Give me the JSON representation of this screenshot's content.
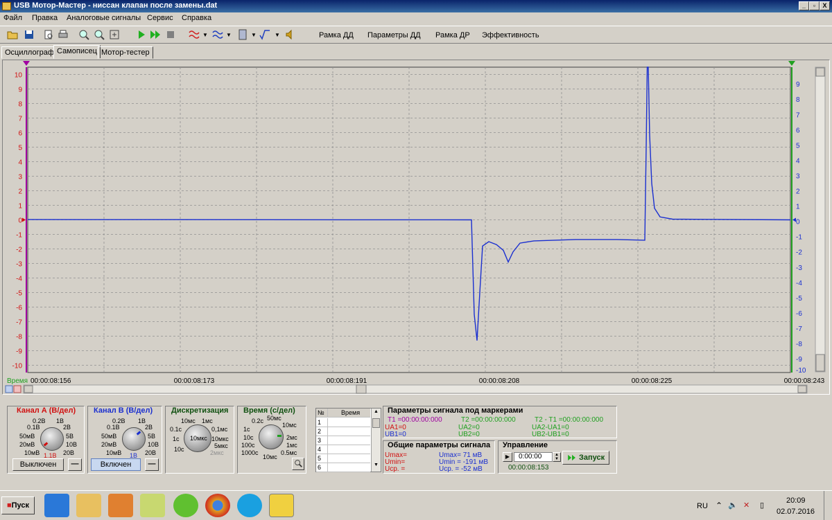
{
  "window": {
    "title": "USB Мотор-Мастер - ниссан клапан после замены.dat",
    "buttons": [
      "_",
      "▫",
      "X"
    ]
  },
  "menu": [
    "Файл",
    "Правка",
    "Аналоговые сигналы",
    "Сервис",
    "Справка"
  ],
  "toolbar": {
    "text_buttons": [
      "Рамка ДД",
      "Параметры ДД",
      "Рамка ДР",
      "Эффективность"
    ]
  },
  "tabs": [
    "Осциллограф",
    "Самописец",
    "Мотор-тестер"
  ],
  "active_tab": "Самописец",
  "plot": {
    "left_ticks": [
      "10",
      "9",
      "8",
      "7",
      "6",
      "5",
      "4",
      "3",
      "2",
      "1",
      "0",
      "-1",
      "-2",
      "-3",
      "-4",
      "-5",
      "-6",
      "-7",
      "-8",
      "-9",
      "-10"
    ],
    "right_ticks": [
      "9",
      "8",
      "7",
      "6",
      "5",
      "4",
      "3",
      "2",
      "1",
      "0",
      "-1",
      "-2",
      "-3",
      "-4",
      "-5",
      "-6",
      "-7",
      "-8",
      "-9",
      "-10"
    ],
    "time_label": "Время",
    "time_ticks": [
      "00:00:08:156",
      "00:00:08:173",
      "00:00:08:191",
      "00:00:08:208",
      "00:00:08:225",
      "00:00:08:243"
    ],
    "colors": {
      "grid": "#909090",
      "signal": "#1a2fd0",
      "left_axis": "#d01010",
      "right_axis": "#1a2fd0",
      "marker_left": "#a000a0",
      "marker_right": "#20a020"
    }
  },
  "chart_data": {
    "type": "line",
    "title": "",
    "xlabel": "Время",
    "ylabel": "",
    "xlim": [
      "00:00:08:156",
      "00:00:08:260"
    ],
    "ylim": [
      -10.5,
      10.5
    ],
    "grid": true,
    "series": [
      {
        "name": "",
        "color": "#1a2fd0",
        "points": [
          {
            "t": 0,
            "v": 0.02
          },
          {
            "t": 64,
            "v": 0.0
          },
          {
            "t": 64.4,
            "v": -6.5
          },
          {
            "t": 64.8,
            "v": -8.3
          },
          {
            "t": 65.2,
            "v": -5.0
          },
          {
            "t": 65.6,
            "v": -1.8
          },
          {
            "t": 66.5,
            "v": -1.5
          },
          {
            "t": 67.6,
            "v": -1.7
          },
          {
            "t": 68.6,
            "v": -2.1
          },
          {
            "t": 69.3,
            "v": -2.9
          },
          {
            "t": 70.0,
            "v": -2.2
          },
          {
            "t": 71.0,
            "v": -1.6
          },
          {
            "t": 73.0,
            "v": -1.45
          },
          {
            "t": 79.0,
            "v": -1.35
          },
          {
            "t": 85.0,
            "v": -1.35
          },
          {
            "t": 89.0,
            "v": -1.4
          },
          {
            "t": 89.2,
            "v": 5.0
          },
          {
            "t": 89.35,
            "v": 10.5
          },
          {
            "t": 89.5,
            "v": 10.5
          },
          {
            "t": 89.7,
            "v": 5.8
          },
          {
            "t": 90.0,
            "v": 2.5
          },
          {
            "t": 90.4,
            "v": 0.8
          },
          {
            "t": 91.2,
            "v": 0.2
          },
          {
            "t": 93.0,
            "v": 0.05
          },
          {
            "t": 110,
            "v": 0.0
          }
        ]
      }
    ]
  },
  "channel_a": {
    "title": "Канал А (В/дел)",
    "labels": [
      "0.2В",
      "1В",
      "0.1В",
      "2В",
      "50мВ",
      "5В",
      "20мВ",
      "10В",
      "10мВ",
      "20В"
    ],
    "value": "1.1В",
    "toggle": "Выключен",
    "color": "#d01010"
  },
  "channel_b": {
    "title": "Канал В (В/дел)",
    "labels": [
      "0.2В",
      "1В",
      "0.1В",
      "2В",
      "50мВ",
      "5В",
      "20мВ",
      "10В",
      "10мВ",
      "20В"
    ],
    "value": "1В",
    "toggle": "Включен",
    "color": "#1a2fd0"
  },
  "discretization": {
    "title": "Дискретизация",
    "labels": [
      "10мс",
      "1мс",
      "0.1с",
      "0,1мс",
      "1с",
      "10мкс",
      "10с",
      "5мкс",
      "2мкс"
    ],
    "value": "10мкс"
  },
  "time_div": {
    "title": "Время (с/дел)",
    "labels": [
      "0.2с",
      "50мс",
      "1с",
      "10мс",
      "10с",
      "2мс",
      "100с",
      "1мс",
      "1000с",
      "0.5мс",
      "10мс"
    ]
  },
  "marker_table": {
    "headers": [
      "№",
      "Время"
    ],
    "rows": [
      "1",
      "2",
      "3",
      "4",
      "5",
      "6"
    ]
  },
  "markers": {
    "title": "Параметры сигнала под маркерами",
    "t1": "T1 =00:00:00:000",
    "ua1": "UA1=0",
    "ub1": "UB1=0",
    "t2": "T2 =00:00:00:000",
    "ua2": "UA2=0",
    "ub2": "UB2=0",
    "t21": "T2 - T1 =00:00:00:000",
    "uadiff": "UA2-UA1=0",
    "ubdiff": "UB2-UB1=0"
  },
  "general": {
    "title": "Общие параметры сигнала",
    "umax_a": "Umax=",
    "umin_a": "Umin=",
    "ucp_a": "Ucp. =",
    "umax_b": "Umax= 71 мВ",
    "umin_b": "Umin = -191 мВ",
    "ucp_b": "Ucp. = -52 мВ"
  },
  "control": {
    "title": "Управление",
    "time_value": "0:00:00",
    "start": "Запуск",
    "elapsed": "00:00:08:153"
  },
  "taskbar": {
    "start": "Пуск",
    "lang": "RU",
    "time": "20:09",
    "date": "02.07.2016"
  }
}
